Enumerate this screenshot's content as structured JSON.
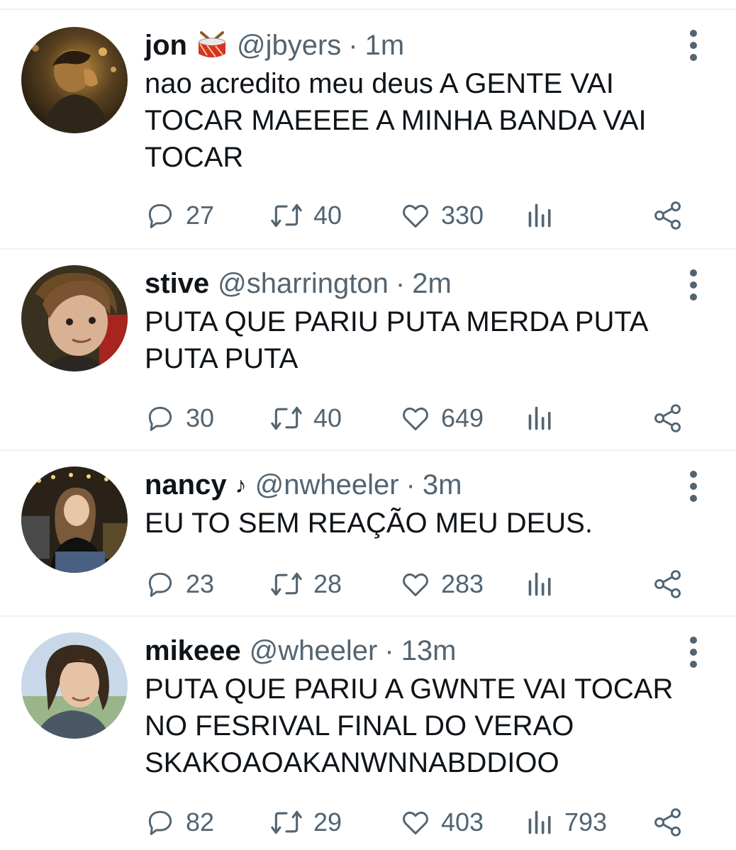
{
  "tweets": [
    {
      "name": "jon",
      "handle": "@jbyers",
      "separator": "·",
      "time": "1m",
      "emoji": "drum-emoji",
      "lines": [
        "nao acredito meu deus A GENTE VAI",
        "TOCAR MAEEEE A MINHA BANDA VAI",
        "TOCAR"
      ],
      "replies": "27",
      "retweets": "40",
      "likes": "330",
      "views": ""
    },
    {
      "name": "stive",
      "handle": "@sharrington",
      "separator": "·",
      "time": "2m",
      "lines": [
        "PUTA QUE PARIU PUTA MERDA PUTA",
        "PUTA PUTA"
      ],
      "replies": "30",
      "retweets": "40",
      "likes": "649",
      "views": ""
    },
    {
      "name": "nancy",
      "note": "♪",
      "handle": "@nwheeler",
      "separator": "·",
      "time": "3m",
      "lines": [
        "EU TO SEM REAÇÃO MEU DEUS."
      ],
      "replies": "23",
      "retweets": "28",
      "likes": "283",
      "views": ""
    },
    {
      "name": "mikeee",
      "handle": "@wheeler",
      "separator": "·",
      "time": "13m",
      "lines": [
        "PUTA QUE PARIU A GWNTE VAI TOCAR",
        "NO FESRIVAL FINAL DO VERAO",
        "SKAKOAOAKANWNNABDDIOO"
      ],
      "replies": "82",
      "retweets": "29",
      "likes": "403",
      "views": "793"
    }
  ],
  "colors": {
    "text": "#0f1419",
    "secondary": "#536471",
    "divider": "#eff3f4"
  },
  "icons": [
    "reply-icon",
    "retweet-icon",
    "like-icon",
    "views-icon",
    "share-icon",
    "more-icon"
  ]
}
